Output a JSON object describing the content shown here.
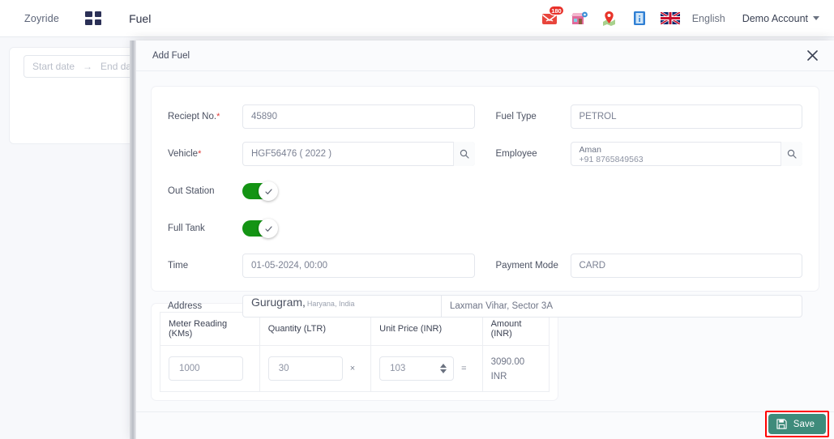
{
  "navbar": {
    "brand": "Zoyride",
    "apps_icon": "grid-apps-icon",
    "page_title": "Fuel",
    "icons": [
      {
        "name": "mail-icon",
        "badge": "180"
      },
      {
        "name": "store-icon"
      },
      {
        "name": "map-pin-icon"
      },
      {
        "name": "info-book-icon"
      },
      {
        "name": "uk-flag-icon"
      }
    ],
    "language": "English",
    "account": "Demo Account",
    "account_caret": "chevron-down-icon"
  },
  "background": {
    "start_date_placeholder": "Start date",
    "range_separator": "→",
    "end_date_placeholder": "End date"
  },
  "modal": {
    "title": "Add Fuel",
    "close_icon": "close-icon",
    "fields": {
      "receipt_label": "Reciept No.",
      "receipt_value": "45890",
      "fuel_type_label": "Fuel Type",
      "fuel_type_value": "PETROL",
      "vehicle_label": "Vehicle",
      "vehicle_value": "HGF56476 ( 2022 )",
      "employee_label": "Employee",
      "employee_name": "Aman",
      "employee_phone": "+91 8765849563",
      "out_station_label": "Out Station",
      "out_station_on": "on",
      "full_tank_label": "Full Tank",
      "full_tank_on": "on",
      "time_label": "Time",
      "time_value": "01-05-2024, 00:00",
      "payment_mode_label": "Payment Mode",
      "payment_mode_value": "CARD",
      "address_label": "Address",
      "address_city": "Gurugram,",
      "address_region": "Haryana, India",
      "address_line": "Laxman Vihar, Sector 3A"
    },
    "table": {
      "headers": [
        "Meter Reading (KMs)",
        "Quantity (LTR)",
        "Unit Price (INR)",
        "Amount (INR)"
      ],
      "meter_reading": "1000",
      "quantity": "30",
      "multiply_symbol": "×",
      "unit_price": "103",
      "equals_symbol": "=",
      "amount": "3090.00 INR"
    },
    "footer": {
      "save_label": "Save",
      "save_icon": "floppy-save-icon",
      "highlight_color": "#ff0000",
      "save_color": "#3e8b7b"
    }
  }
}
